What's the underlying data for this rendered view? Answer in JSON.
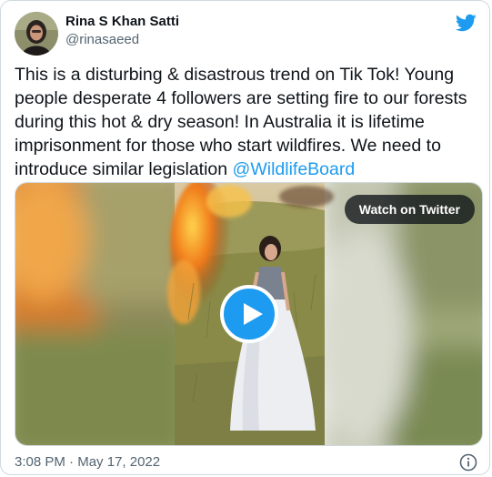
{
  "tweet": {
    "author_name": "Rina S Khan Satti",
    "author_handle": "@rinasaeed",
    "text": "This is a disturbing & disastrous trend on Tik Tok! Young people desperate 4 followers are setting fire to our forests during this hot & dry season! In Australia it is lifetime imprisonment for those who start wildfires. We need to introduce similar legislation ",
    "mention": "@WildlifeBoard",
    "time": "3:08 PM",
    "separator": "·",
    "date": "May 17, 2022"
  },
  "media": {
    "watch_label": "Watch on Twitter"
  },
  "icons": {
    "brand": "twitter-bird-icon",
    "play": "play-icon",
    "info": "info-icon"
  },
  "colors": {
    "accent": "#1d9bf0",
    "text": "#0f1419",
    "secondary": "#536471",
    "border": "#cfd9de"
  }
}
